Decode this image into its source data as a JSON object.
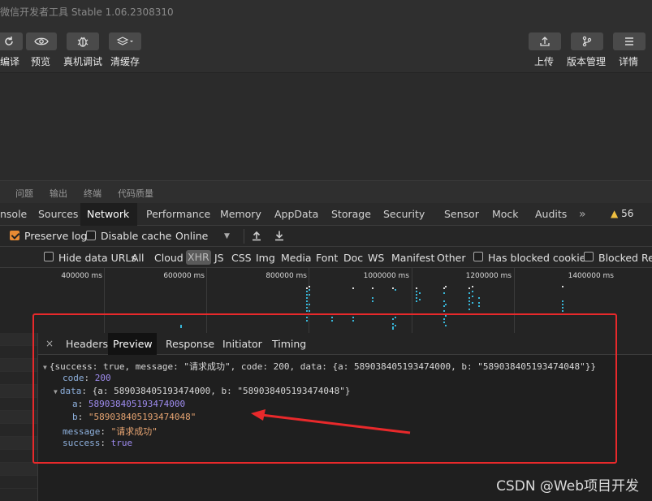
{
  "window": {
    "title": "微信开发者工具 Stable 1.06.2308310"
  },
  "toolbar": {
    "left": [
      {
        "label": "编译",
        "icon": "refresh-icon"
      },
      {
        "label": "预览",
        "icon": "eye-icon"
      },
      {
        "label": "真机调试",
        "icon": "bug-icon"
      },
      {
        "label": "清缓存",
        "icon": "layers-icon"
      }
    ],
    "right": [
      {
        "label": "上传",
        "icon": "upload-icon"
      },
      {
        "label": "版本管理",
        "icon": "branch-icon"
      },
      {
        "label": "详情",
        "icon": "menu-icon"
      }
    ]
  },
  "panel_tabs": [
    "问题",
    "输出",
    "终端",
    "代码质量"
  ],
  "devtools_tabs": [
    "nsole",
    "Sources",
    "Network",
    "Performance",
    "Memory",
    "AppData",
    "Storage",
    "Security",
    "Sensor",
    "Mock",
    "Audits"
  ],
  "devtools_active_tab": "Network",
  "devtools_more": "»",
  "warnings": {
    "icon": "warning-icon",
    "count": "56"
  },
  "network_toolbar": {
    "preserve_log": "Preserve log",
    "disable_cache": "Disable cache",
    "throttle": "Online",
    "preserve_checked": true
  },
  "filter": {
    "hide_data_urls": "Hide data URLs",
    "types": [
      "All",
      "Cloud",
      "XHR",
      "JS",
      "CSS",
      "Img",
      "Media",
      "Font",
      "Doc",
      "WS",
      "Manifest",
      "Other"
    ],
    "selected_type": "XHR",
    "has_blocked_cookies": "Has blocked cookies",
    "blocked_requests": "Blocked Requ"
  },
  "timeline": {
    "ticks": [
      "400000 ms",
      "600000 ms",
      "800000 ms",
      "1000000 ms",
      "1200000 ms",
      "1400000 ms"
    ]
  },
  "detail": {
    "close": "×",
    "tabs": [
      "Headers",
      "Preview",
      "Response",
      "Initiator",
      "Timing"
    ],
    "active_tab": "Preview",
    "preview": {
      "summary": "{success: true, message: \"请求成功\", code: 200, data: {a: 589038405193474000, b: \"589038405193474048\"}}",
      "code_key": "code",
      "code_val": "200",
      "data_key": "data",
      "data_summary": "{a: 589038405193474000, b: \"589038405193474048\"}",
      "a_key": "a",
      "a_val": "589038405193474000",
      "b_key": "b",
      "b_val": "\"589038405193474048\"",
      "message_key": "message",
      "message_val": "\"请求成功\"",
      "success_key": "success",
      "success_val": "true"
    }
  },
  "watermark": "CSDN @Web项目开发",
  "colors": {
    "annotation": "#e8292b",
    "active_tab_bg": "#1e1e1e",
    "checkbox": "#e88a33"
  }
}
